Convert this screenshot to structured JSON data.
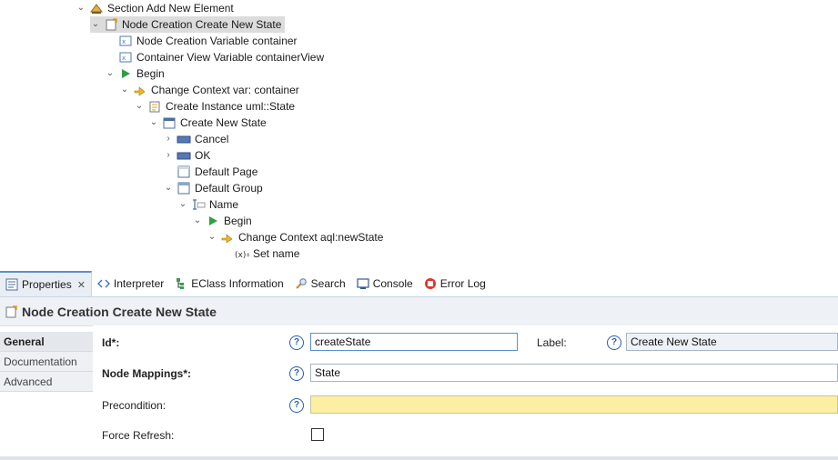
{
  "tree": {
    "items": [
      {
        "label": "Section Add New Element",
        "icon": "section-icon"
      },
      {
        "label": "Node Creation Create New State",
        "icon": "node-creation-icon"
      },
      {
        "label": "Node Creation Variable container",
        "icon": "variable-icon"
      },
      {
        "label": "Container View Variable containerView",
        "icon": "variable-icon"
      },
      {
        "label": "Begin",
        "icon": "begin-icon"
      },
      {
        "label": "Change Context var: container",
        "icon": "change-context-icon"
      },
      {
        "label": "Create Instance uml::State",
        "icon": "create-instance-icon"
      },
      {
        "label": "Create New State",
        "icon": "dialog-icon"
      },
      {
        "label": "Cancel",
        "icon": "button-widget-icon"
      },
      {
        "label": "OK",
        "icon": "button-widget-icon"
      },
      {
        "label": "Default Page",
        "icon": "page-icon"
      },
      {
        "label": "Default Group",
        "icon": "group-icon"
      },
      {
        "label": "Name",
        "icon": "text-widget-icon"
      },
      {
        "label": "Begin",
        "icon": "begin-icon"
      },
      {
        "label": "Change Context aql:newState",
        "icon": "change-context-icon"
      },
      {
        "label": "Set name",
        "icon": "set-icon"
      }
    ]
  },
  "tabs": [
    {
      "label": "Properties",
      "icon": "properties-icon"
    },
    {
      "label": "Interpreter",
      "icon": "interpreter-icon"
    },
    {
      "label": "EClass Information",
      "icon": "eclass-icon"
    },
    {
      "label": "Search",
      "icon": "search-icon"
    },
    {
      "label": "Console",
      "icon": "console-icon"
    },
    {
      "label": "Error Log",
      "icon": "error-log-icon"
    }
  ],
  "panel": {
    "title": "Node Creation Create New State",
    "side_tabs": [
      "General",
      "Documentation",
      "Advanced"
    ],
    "form": {
      "id_label": "Id*:",
      "id_value": "createState",
      "label_label": "Label:",
      "label_value": "Create New State",
      "node_mappings_label": "Node Mappings*:",
      "node_mappings_value": "State",
      "precondition_label": "Precondition:",
      "precondition_value": "",
      "force_refresh_label": "Force Refresh:",
      "force_refresh_checked": false,
      "help_glyph": "?"
    }
  },
  "colors": {
    "accent": "#5b8fcc",
    "precondition_bg": "#fcefa1",
    "begin_green": "#2ea043"
  }
}
